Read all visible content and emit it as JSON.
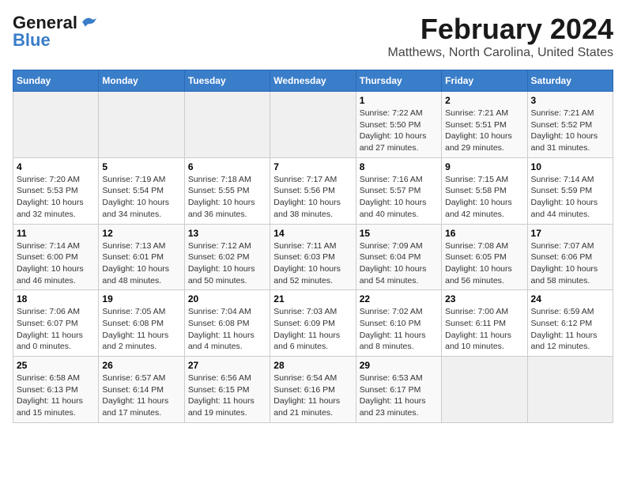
{
  "app": {
    "name1": "General",
    "name2": "Blue"
  },
  "title": "February 2024",
  "subtitle": "Matthews, North Carolina, United States",
  "days_of_week": [
    "Sunday",
    "Monday",
    "Tuesday",
    "Wednesday",
    "Thursday",
    "Friday",
    "Saturday"
  ],
  "weeks": [
    [
      {
        "day": "",
        "info": ""
      },
      {
        "day": "",
        "info": ""
      },
      {
        "day": "",
        "info": ""
      },
      {
        "day": "",
        "info": ""
      },
      {
        "day": "1",
        "info": "Sunrise: 7:22 AM\nSunset: 5:50 PM\nDaylight: 10 hours\nand 27 minutes."
      },
      {
        "day": "2",
        "info": "Sunrise: 7:21 AM\nSunset: 5:51 PM\nDaylight: 10 hours\nand 29 minutes."
      },
      {
        "day": "3",
        "info": "Sunrise: 7:21 AM\nSunset: 5:52 PM\nDaylight: 10 hours\nand 31 minutes."
      }
    ],
    [
      {
        "day": "4",
        "info": "Sunrise: 7:20 AM\nSunset: 5:53 PM\nDaylight: 10 hours\nand 32 minutes."
      },
      {
        "day": "5",
        "info": "Sunrise: 7:19 AM\nSunset: 5:54 PM\nDaylight: 10 hours\nand 34 minutes."
      },
      {
        "day": "6",
        "info": "Sunrise: 7:18 AM\nSunset: 5:55 PM\nDaylight: 10 hours\nand 36 minutes."
      },
      {
        "day": "7",
        "info": "Sunrise: 7:17 AM\nSunset: 5:56 PM\nDaylight: 10 hours\nand 38 minutes."
      },
      {
        "day": "8",
        "info": "Sunrise: 7:16 AM\nSunset: 5:57 PM\nDaylight: 10 hours\nand 40 minutes."
      },
      {
        "day": "9",
        "info": "Sunrise: 7:15 AM\nSunset: 5:58 PM\nDaylight: 10 hours\nand 42 minutes."
      },
      {
        "day": "10",
        "info": "Sunrise: 7:14 AM\nSunset: 5:59 PM\nDaylight: 10 hours\nand 44 minutes."
      }
    ],
    [
      {
        "day": "11",
        "info": "Sunrise: 7:14 AM\nSunset: 6:00 PM\nDaylight: 10 hours\nand 46 minutes."
      },
      {
        "day": "12",
        "info": "Sunrise: 7:13 AM\nSunset: 6:01 PM\nDaylight: 10 hours\nand 48 minutes."
      },
      {
        "day": "13",
        "info": "Sunrise: 7:12 AM\nSunset: 6:02 PM\nDaylight: 10 hours\nand 50 minutes."
      },
      {
        "day": "14",
        "info": "Sunrise: 7:11 AM\nSunset: 6:03 PM\nDaylight: 10 hours\nand 52 minutes."
      },
      {
        "day": "15",
        "info": "Sunrise: 7:09 AM\nSunset: 6:04 PM\nDaylight: 10 hours\nand 54 minutes."
      },
      {
        "day": "16",
        "info": "Sunrise: 7:08 AM\nSunset: 6:05 PM\nDaylight: 10 hours\nand 56 minutes."
      },
      {
        "day": "17",
        "info": "Sunrise: 7:07 AM\nSunset: 6:06 PM\nDaylight: 10 hours\nand 58 minutes."
      }
    ],
    [
      {
        "day": "18",
        "info": "Sunrise: 7:06 AM\nSunset: 6:07 PM\nDaylight: 11 hours\nand 0 minutes."
      },
      {
        "day": "19",
        "info": "Sunrise: 7:05 AM\nSunset: 6:08 PM\nDaylight: 11 hours\nand 2 minutes."
      },
      {
        "day": "20",
        "info": "Sunrise: 7:04 AM\nSunset: 6:08 PM\nDaylight: 11 hours\nand 4 minutes."
      },
      {
        "day": "21",
        "info": "Sunrise: 7:03 AM\nSunset: 6:09 PM\nDaylight: 11 hours\nand 6 minutes."
      },
      {
        "day": "22",
        "info": "Sunrise: 7:02 AM\nSunset: 6:10 PM\nDaylight: 11 hours\nand 8 minutes."
      },
      {
        "day": "23",
        "info": "Sunrise: 7:00 AM\nSunset: 6:11 PM\nDaylight: 11 hours\nand 10 minutes."
      },
      {
        "day": "24",
        "info": "Sunrise: 6:59 AM\nSunset: 6:12 PM\nDaylight: 11 hours\nand 12 minutes."
      }
    ],
    [
      {
        "day": "25",
        "info": "Sunrise: 6:58 AM\nSunset: 6:13 PM\nDaylight: 11 hours\nand 15 minutes."
      },
      {
        "day": "26",
        "info": "Sunrise: 6:57 AM\nSunset: 6:14 PM\nDaylight: 11 hours\nand 17 minutes."
      },
      {
        "day": "27",
        "info": "Sunrise: 6:56 AM\nSunset: 6:15 PM\nDaylight: 11 hours\nand 19 minutes."
      },
      {
        "day": "28",
        "info": "Sunrise: 6:54 AM\nSunset: 6:16 PM\nDaylight: 11 hours\nand 21 minutes."
      },
      {
        "day": "29",
        "info": "Sunrise: 6:53 AM\nSunset: 6:17 PM\nDaylight: 11 hours\nand 23 minutes."
      },
      {
        "day": "",
        "info": ""
      },
      {
        "day": "",
        "info": ""
      }
    ]
  ]
}
